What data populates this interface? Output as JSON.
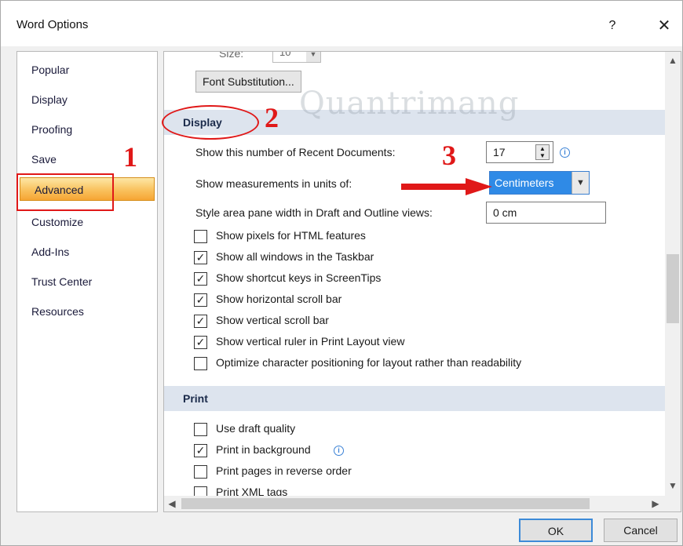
{
  "window": {
    "title": "Word Options",
    "help_label": "?",
    "close_glyph": "✕"
  },
  "sidebar": {
    "items": [
      {
        "label": "Popular"
      },
      {
        "label": "Display"
      },
      {
        "label": "Proofing"
      },
      {
        "label": "Save"
      },
      {
        "label": "Advanced"
      },
      {
        "label": "Customize"
      },
      {
        "label": "Add-Ins"
      },
      {
        "label": "Trust Center"
      },
      {
        "label": "Resources"
      }
    ],
    "selected": "Advanced",
    "selected_color": "#f9c15d"
  },
  "content": {
    "size_label": "Size:",
    "size_value": "10",
    "font_substitution_button": "Font Substitution...",
    "display_section": {
      "header": "Display",
      "recent_docs_label": "Show this number of Recent Documents:",
      "recent_docs_value": "17",
      "measurement_label": "Show measurements in units of:",
      "measurement_value": "Centimeters",
      "style_area_label": "Style area pane width in Draft and Outline views:",
      "style_area_value": "0 cm",
      "checkboxes": [
        {
          "label": "Show pixels for HTML features",
          "checked": false
        },
        {
          "label": "Show all windows in the Taskbar",
          "checked": true
        },
        {
          "label": "Show shortcut keys in ScreenTips",
          "checked": true
        },
        {
          "label": "Show horizontal scroll bar",
          "checked": true
        },
        {
          "label": "Show vertical scroll bar",
          "checked": true
        },
        {
          "label": "Show vertical ruler in Print Layout view",
          "checked": true
        },
        {
          "label": "Optimize character positioning for layout rather than readability",
          "checked": false
        }
      ]
    },
    "print_section": {
      "header": "Print",
      "checkboxes": [
        {
          "label": "Use draft quality",
          "checked": false
        },
        {
          "label": "Print in background",
          "checked": true
        },
        {
          "label": "Print pages in reverse order",
          "checked": false
        },
        {
          "label": "Print XML tags",
          "checked": false
        }
      ]
    }
  },
  "footer": {
    "ok_label": "OK",
    "cancel_label": "Cancel"
  },
  "annotations": {
    "step1": "1",
    "step2": "2",
    "step3": "3",
    "color": "#e01818",
    "watermark": "Quantrimang"
  },
  "icons": {
    "spin": "spin-arrows-icon",
    "info": "info-icon",
    "dropdown": "chevron-down-icon",
    "scroll_up": "scroll-up-icon",
    "scroll_down": "scroll-down-icon",
    "scroll_left": "scroll-left-icon",
    "scroll_right": "scroll-right-icon"
  }
}
